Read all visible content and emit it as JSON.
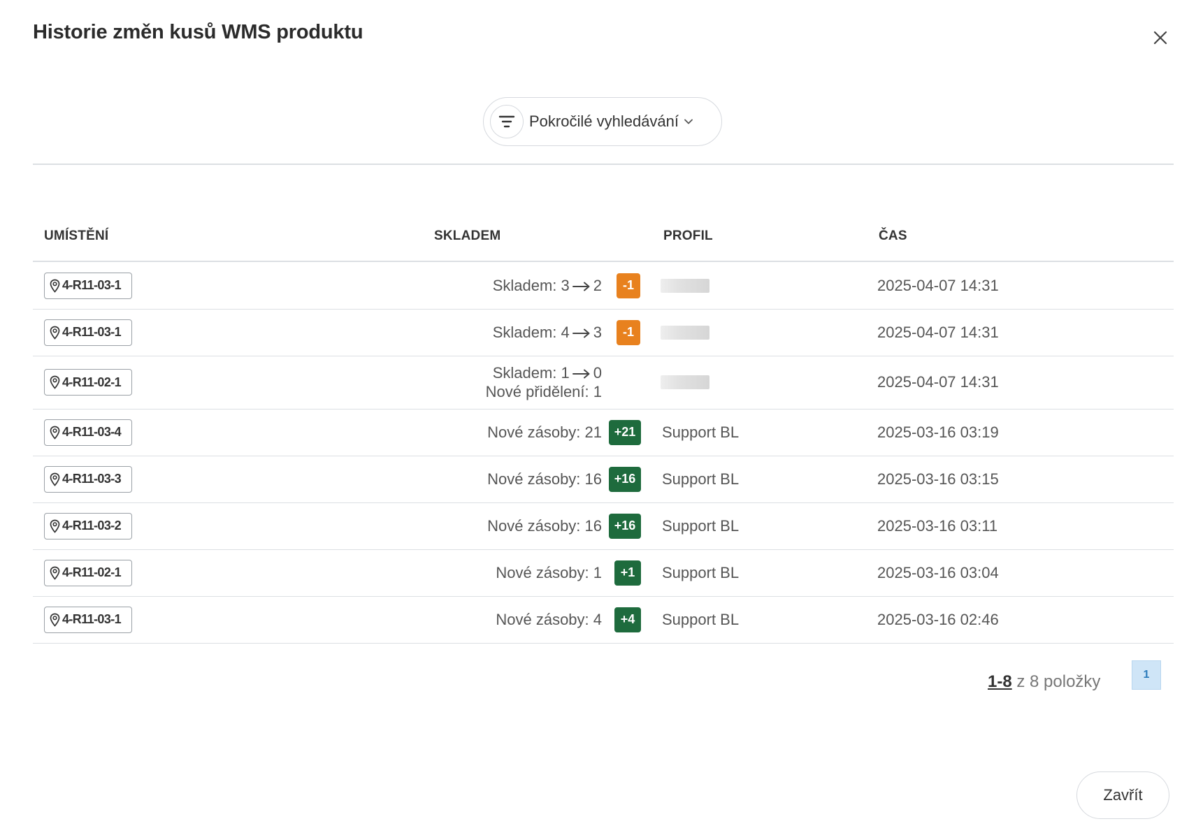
{
  "modal": {
    "title": "Historie změn kusů WMS produktu"
  },
  "filter": {
    "label": "Pokročilé vyhledávání"
  },
  "table": {
    "headers": {
      "location": "UMÍSTĚNÍ",
      "stock": "SKLADEM",
      "profile": "PROFIL",
      "time": "ČAS"
    },
    "rows": [
      {
        "location": "4-R11-03-1",
        "stock_lines": [
          "Skladem: 3 → 2"
        ],
        "badge": "-1",
        "badge_type": "negative",
        "profile": "",
        "profile_hidden": true,
        "time": "2025-04-07 14:31"
      },
      {
        "location": "4-R11-03-1",
        "stock_lines": [
          "Skladem: 4 → 3"
        ],
        "badge": "-1",
        "badge_type": "negative",
        "profile": "",
        "profile_hidden": true,
        "time": "2025-04-07 14:31"
      },
      {
        "location": "4-R11-02-1",
        "stock_lines": [
          "Skladem: 1 → 0",
          "Nové přidělení: 1"
        ],
        "badge": "",
        "badge_type": "none",
        "profile": "",
        "profile_hidden": true,
        "time": "2025-04-07 14:31"
      },
      {
        "location": "4-R11-03-4",
        "stock_lines": [
          "Nové zásoby: 21"
        ],
        "badge": "+21",
        "badge_type": "positive",
        "profile": "Support BL",
        "profile_hidden": false,
        "time": "2025-03-16 03:19"
      },
      {
        "location": "4-R11-03-3",
        "stock_lines": [
          "Nové zásoby: 16"
        ],
        "badge": "+16",
        "badge_type": "positive",
        "profile": "Support BL",
        "profile_hidden": false,
        "time": "2025-03-16 03:15"
      },
      {
        "location": "4-R11-03-2",
        "stock_lines": [
          "Nové zásoby: 16"
        ],
        "badge": "+16",
        "badge_type": "positive",
        "profile": "Support BL",
        "profile_hidden": false,
        "time": "2025-03-16 03:11"
      },
      {
        "location": "4-R11-02-1",
        "stock_lines": [
          "Nové zásoby: 1"
        ],
        "badge": "+1",
        "badge_type": "positive",
        "profile": "Support BL",
        "profile_hidden": false,
        "time": "2025-03-16 03:04"
      },
      {
        "location": "4-R11-03-1",
        "stock_lines": [
          "Nové zásoby: 4"
        ],
        "badge": "+4",
        "badge_type": "positive",
        "profile": "Support BL",
        "profile_hidden": false,
        "time": "2025-03-16 02:46"
      }
    ]
  },
  "pagination": {
    "range": "1-8",
    "rest": "z 8 položky",
    "current_page": "1"
  },
  "footer": {
    "close_label": "Zavřít"
  },
  "colors": {
    "negative_badge": "#e8811e",
    "positive_badge": "#1e6b3d",
    "page_active_bg": "#cfe5f7"
  },
  "icons": {
    "close": "close-icon",
    "filter": "filter-icon",
    "chevron": "chevron-down-icon",
    "location": "map-pin-icon",
    "arrow": "arrow-right-icon"
  }
}
